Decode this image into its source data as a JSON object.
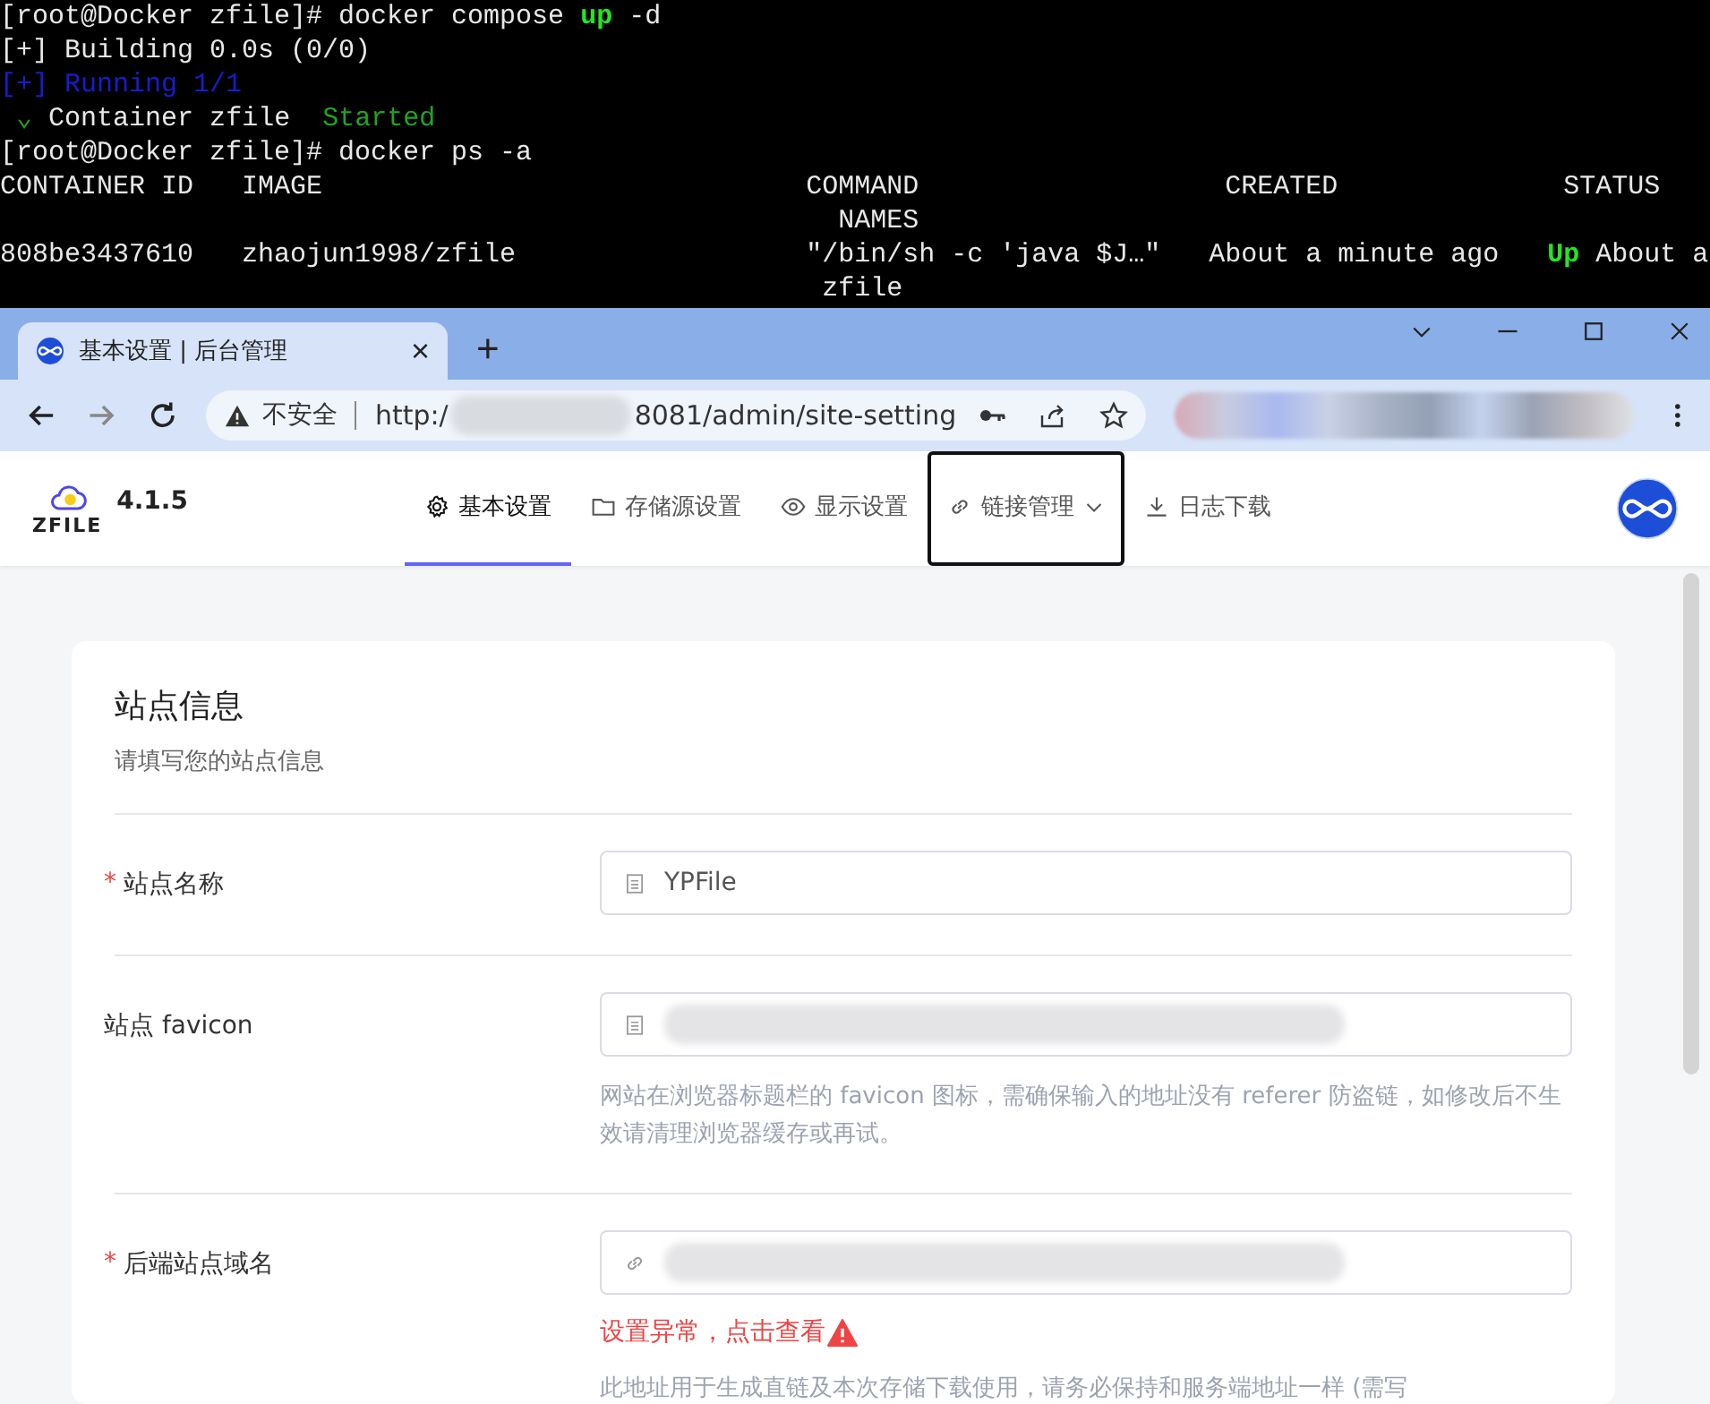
{
  "terminal": {
    "lines": [
      [
        {
          "text": "[root@Docker zfile]# docker compose ",
          "kind": "plain"
        },
        {
          "text": "up",
          "kind": "bright"
        },
        {
          "text": " -d",
          "kind": "plain"
        }
      ],
      [
        {
          "text": "[+] Building 0.0s (0/0)",
          "kind": "plain"
        }
      ],
      [
        {
          "text": "[+] Running 1/1",
          "kind": "blue"
        }
      ],
      [
        {
          "text": " ⌄ ",
          "kind": "green"
        },
        {
          "text": "Container zfile  ",
          "kind": "plain"
        },
        {
          "text": "Started",
          "kind": "green"
        }
      ],
      [
        {
          "text": "[root@Docker zfile]# docker ps -a",
          "kind": "plain"
        }
      ],
      [
        {
          "text": "CONTAINER ID   IMAGE                              COMMAND                   CREATED              STATUS",
          "kind": "plain"
        }
      ],
      [
        {
          "text": "                                                    NAMES",
          "kind": "plain"
        }
      ],
      [
        {
          "text": "808be3437610   zhaojun1998/zfile                  \"/bin/sh -c 'java $J…\"   About a minute ago   ",
          "kind": "plain"
        },
        {
          "text": "Up",
          "kind": "bright"
        },
        {
          "text": " About a",
          "kind": "plain"
        }
      ],
      [
        {
          "text": "                                                   zfile",
          "kind": "plain"
        }
      ]
    ]
  },
  "browser": {
    "tab": {
      "title": "基本设置 | 后台管理",
      "close": "×"
    },
    "new_tab": "+",
    "security": "不安全",
    "url_start": "http:/",
    "url_end": "8081/admin/site-setting"
  },
  "app": {
    "version": "4.1.5",
    "logo_text": "ZFILE",
    "nav": [
      {
        "label": "基本设置",
        "kind": "gear",
        "selected": true,
        "focused": false,
        "dropdown": false
      },
      {
        "label": "存储源设置",
        "kind": "folder",
        "selected": false,
        "focused": false,
        "dropdown": false
      },
      {
        "label": "显示设置",
        "kind": "eye",
        "selected": false,
        "focused": false,
        "dropdown": false
      },
      {
        "label": "链接管理",
        "kind": "link",
        "selected": false,
        "focused": true,
        "dropdown": true
      },
      {
        "label": "日志下载",
        "kind": "download",
        "selected": false,
        "focused": false,
        "dropdown": false
      }
    ]
  },
  "section": {
    "title": "站点信息",
    "subtitle": "请填写您的站点信息",
    "fields": [
      {
        "label": "站点名称",
        "required_mark": "*",
        "kind": "doc",
        "value": "YPFile",
        "redacted": false
      },
      {
        "label": "站点 favicon",
        "kind": "doc",
        "redacted": true,
        "help": "网站在浏览器标题栏的 favicon 图标，需确保输入的地址没有 referer 防盗链，如修改后不生效请清理浏览器缓存或再试。"
      },
      {
        "label": "后端站点域名",
        "required_mark": "*",
        "kind": "link",
        "redacted": true,
        "error": "设置异常，点击查看",
        "help": "此地址用于生成直链及本次存储下载使用，请务必保持和服务端地址一样 (需写"
      }
    ]
  }
}
